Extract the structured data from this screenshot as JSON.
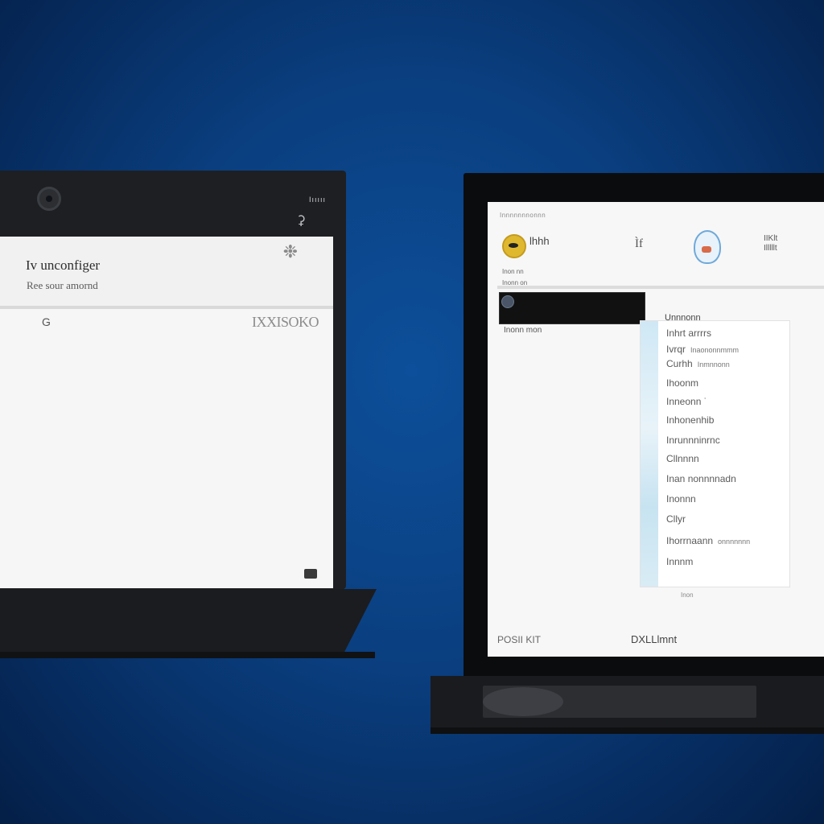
{
  "left": {
    "top_text": "Iııııı",
    "top_icon": "bell-icon",
    "title": "Iv unconfiger",
    "subtitle": "Ree sour amornd",
    "settings_icon": "gear-icon",
    "toolbar_icon_label": "G",
    "toolbar_button_label": "IXXISOKO",
    "corner_button_icon": "window-icon"
  },
  "right": {
    "top_label": "Innnnnnnonnn",
    "app1_label": "lhhh",
    "app2_label": "Ìf",
    "app4_label": "IIKlt\nIlllllt",
    "nav_items": [
      "Inon nn",
      "Inonn on"
    ],
    "search_icon": "search-icon",
    "side_label": "Inonn mon",
    "panel_header": "Unnnonn",
    "panel_rows": [
      {
        "label": "Inhrt arrrrs",
        "sub": ""
      },
      {
        "label": "Ivrqr",
        "sub": "Inaononnmmm"
      },
      {
        "label": "Curhh",
        "sub": "Inmnnonn"
      },
      {
        "label": "Ihoonm",
        "sub": ""
      },
      {
        "label": "Inneonn ˙",
        "sub": ""
      },
      {
        "label": "Inhonenhib",
        "sub": ""
      },
      {
        "label": "Inrunnninrnc",
        "sub": ""
      },
      {
        "label": "Cllnnnn",
        "sub": ""
      },
      {
        "label": "Inan nonnnnadn",
        "sub": ""
      },
      {
        "label": "Inonnn",
        "sub": ""
      },
      {
        "label": "Cllyr",
        "sub": ""
      },
      {
        "label": "Ihorrnaann",
        "sub": "onnnnnnn"
      },
      {
        "label": "Innnm",
        "sub": ""
      }
    ],
    "panel_footer": "Inon",
    "bottom_left": "POSII KIT",
    "bottom_mid": "DXLLlmnt"
  }
}
